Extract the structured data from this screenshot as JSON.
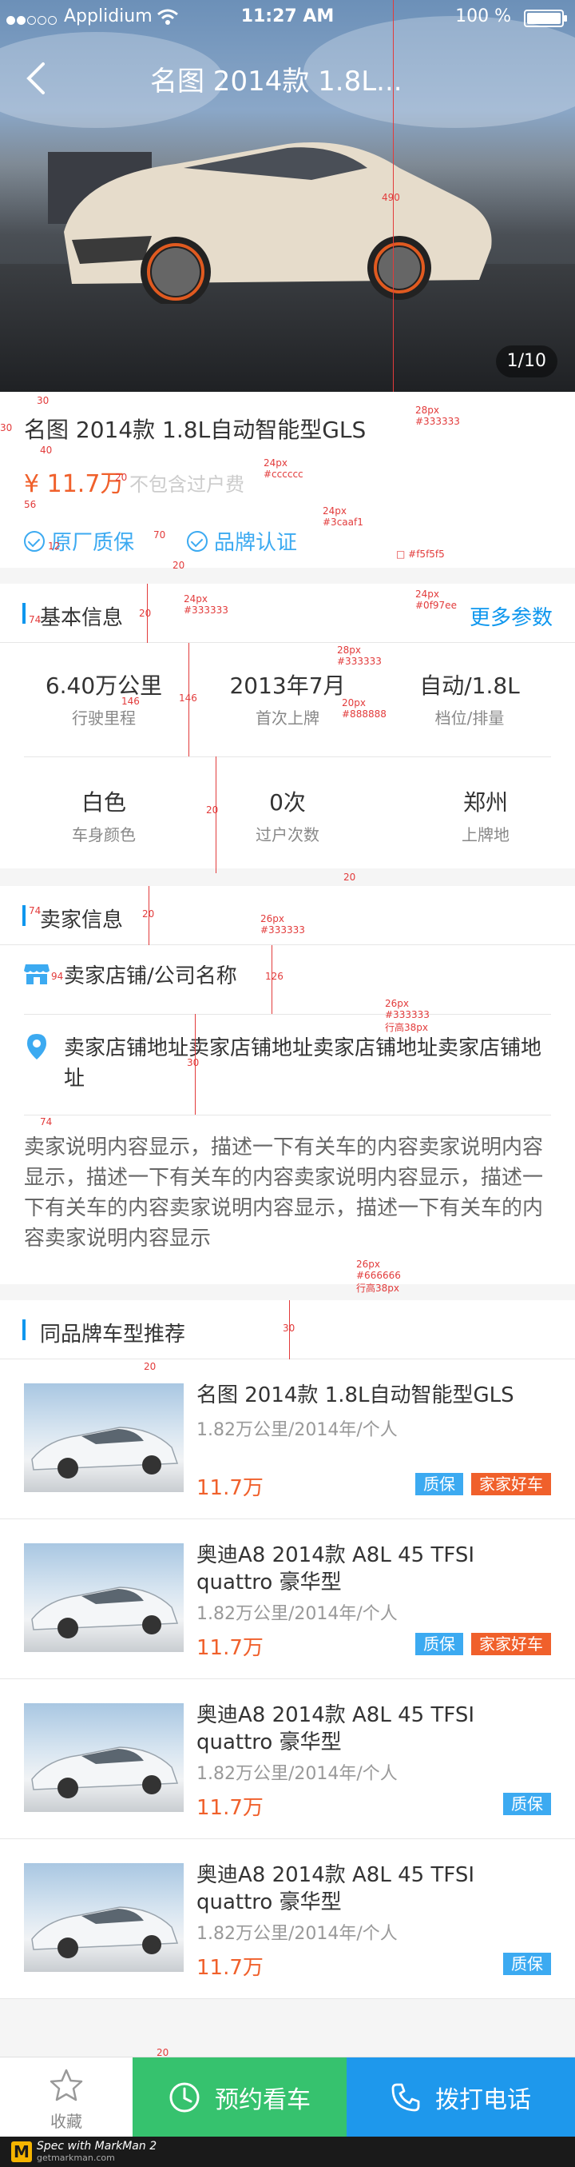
{
  "status_bar": {
    "carrier": "Applidium",
    "time": "11:27 AM",
    "battery": "100 %"
  },
  "nav": {
    "title": "名图 2014款  1.8L..."
  },
  "gallery": {
    "pager": "1/10"
  },
  "car": {
    "title": "名图 2014款  1.8L自动智能型GLS",
    "price": "¥ 11.7万",
    "price_note": "不包含过户费",
    "badges": [
      "原厂质保",
      "品牌认证"
    ]
  },
  "basic_info": {
    "heading": "基本信息",
    "more": "更多参数",
    "items": [
      {
        "value": "6.40万公里",
        "label": "行驶里程"
      },
      {
        "value": "2013年7月",
        "label": "首次上牌"
      },
      {
        "value": "自动/1.8L",
        "label": "档位/排量"
      },
      {
        "value": "白色",
        "label": "车身颜色"
      },
      {
        "value": "0次",
        "label": "过户次数"
      },
      {
        "value": "郑州",
        "label": "上牌地"
      }
    ]
  },
  "seller": {
    "heading": "卖家信息",
    "shop_name": "卖家店铺/公司名称",
    "address": "卖家店铺地址卖家店铺地址卖家店铺地址卖家店铺地址",
    "description": "卖家说明内容显示，描述一下有关车的内容卖家说明内容显示，描述一下有关车的内容卖家说明内容显示，描述一下有关车的内容卖家说明内容显示，描述一下有关车的内容卖家说明内容显示"
  },
  "recommend": {
    "heading": "同品牌车型推荐",
    "items": [
      {
        "name": "名图 2014款  1.8L自动智能型GLS",
        "meta": "1.82万公里/2014年/个人",
        "price": "11.7万",
        "tags": [
          "质保",
          "家家好车"
        ]
      },
      {
        "name": "奥迪A8 2014款  A8L 45  TFSI quattro 豪华型",
        "meta": "1.82万公里/2014年/个人",
        "price": "11.7万",
        "tags": [
          "质保",
          "家家好车"
        ]
      },
      {
        "name": "奥迪A8 2014款  A8L 45  TFSI quattro 豪华型",
        "meta": "1.82万公里/2014年/个人",
        "price": "11.7万",
        "tags": [
          "质保"
        ]
      },
      {
        "name": "奥迪A8 2014款  A8L 45  TFSI quattro 豪华型",
        "meta": "1.82万公里/2014年/个人",
        "price": "11.7万",
        "tags": [
          "质保"
        ]
      }
    ]
  },
  "bottom_bar": {
    "favorite": "收藏",
    "book_viewing": "预约看车",
    "call": "拨打电话"
  },
  "spec_annotations": {
    "numbers": [
      "30",
      "30",
      "40",
      "56",
      "12",
      "70",
      "20",
      "20",
      "74",
      "20",
      "146",
      "146",
      "20",
      "20",
      "74",
      "20",
      "94",
      "126",
      "30",
      "74",
      "30",
      "490",
      "20",
      "20"
    ],
    "notes": [
      {
        "size": "28px",
        "color": "#333333"
      },
      {
        "size": "24px",
        "color": "#cccccc"
      },
      {
        "size": "24px",
        "color": "#3caaf1"
      },
      {
        "color": "#f5f5f5"
      },
      {
        "size": "24px",
        "color": "#0f97ee"
      },
      {
        "size": "24px",
        "color": "#333333"
      },
      {
        "size": "28px",
        "color": "#333333"
      },
      {
        "size": "20px",
        "color": "#888888"
      },
      {
        "size": "26px",
        "color": "#333333"
      },
      {
        "size": "26px",
        "color": "#333333",
        "line_height": "行高38px"
      },
      {
        "size": "26px",
        "color": "#666666",
        "line_height": "行高38px"
      }
    ]
  },
  "markman": {
    "brand": "Spec with MarkMan 2",
    "url": "getmarkman.com"
  },
  "colors": {
    "accent_blue": "#0f97ee",
    "badge_blue": "#3caaf1",
    "price_orange": "#f0602b",
    "green": "#36c26e",
    "call_blue": "#1e98ec",
    "bg": "#f5f5f5"
  }
}
